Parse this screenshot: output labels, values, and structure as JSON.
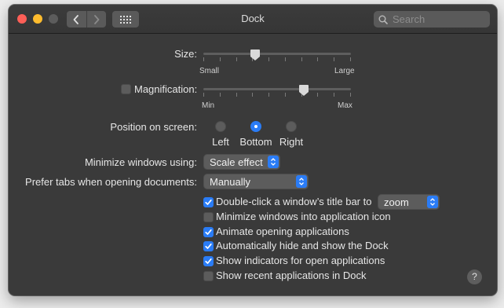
{
  "window": {
    "title": "Dock"
  },
  "toolbar": {
    "back_icon": "chevron-left-icon",
    "forward_icon": "chevron-right-icon",
    "show_all_icon": "grid-icon"
  },
  "search": {
    "placeholder": "Search",
    "value": "",
    "icon": "search-icon"
  },
  "size": {
    "label": "Size:",
    "min_label": "Small",
    "max_label": "Large",
    "value": 0.35
  },
  "magnification": {
    "label": "Magnification:",
    "checked": false,
    "min_label": "Min",
    "max_label": "Max",
    "value": 0.68
  },
  "position": {
    "label": "Position on screen:",
    "options": [
      "Left",
      "Bottom",
      "Right"
    ],
    "selected": "Bottom"
  },
  "minimize": {
    "label": "Minimize windows using:",
    "value": "Scale effect"
  },
  "prefer_tabs": {
    "label": "Prefer tabs when opening documents:",
    "value": "Manually"
  },
  "options": {
    "double_click": {
      "label": "Double-click a window’s title bar to",
      "checked": true,
      "value": "zoom"
    },
    "minimize_into_icon": {
      "label": "Minimize windows into application icon",
      "checked": false
    },
    "animate": {
      "label": "Animate opening applications",
      "checked": true
    },
    "autohide": {
      "label": "Automatically hide and show the Dock",
      "checked": true
    },
    "indicators": {
      "label": "Show indicators for open applications",
      "checked": true
    },
    "recent": {
      "label": "Show recent applications in Dock",
      "checked": false
    }
  },
  "help": {
    "label": "?"
  },
  "colors": {
    "accent": "#2a7cf6",
    "background": "#3a3a3a",
    "control": "#5c5c5c"
  }
}
